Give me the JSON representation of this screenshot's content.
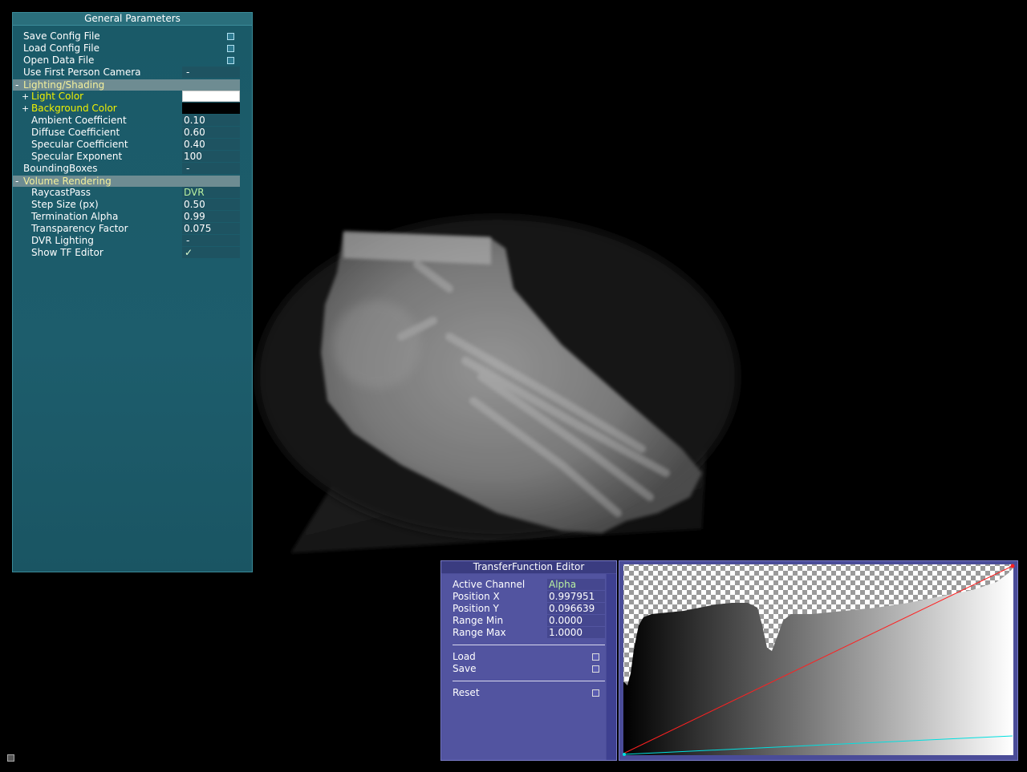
{
  "general_parameters": {
    "title": "General Parameters",
    "save_config": "Save Config File",
    "load_config": "Load Config File",
    "open_data": "Open Data File",
    "first_person_camera": {
      "label": "Use First Person Camera",
      "value": "-"
    },
    "lighting_section": "Lighting/Shading",
    "light_color": {
      "label": "Light Color",
      "color": "#ffffff"
    },
    "background_color": {
      "label": "Background Color",
      "color": "#000000"
    },
    "ambient": {
      "label": "Ambient Coefficient",
      "value": "0.10"
    },
    "diffuse": {
      "label": "Diffuse Coefficient",
      "value": "0.60"
    },
    "specular": {
      "label": "Specular Coefficient",
      "value": "0.40"
    },
    "specular_exp": {
      "label": "Specular Exponent",
      "value": "100"
    },
    "bounding_boxes": {
      "label": "BoundingBoxes",
      "value": "-"
    },
    "volume_section": "Volume Rendering",
    "raycast_pass": {
      "label": "RaycastPass",
      "value": "DVR"
    },
    "step_size": {
      "label": "Step Size (px)",
      "value": "0.50"
    },
    "termination_alpha": {
      "label": "Termination Alpha",
      "value": "0.99"
    },
    "transparency_factor": {
      "label": "Transparency Factor",
      "value": "0.075"
    },
    "dvr_lighting": {
      "label": "DVR Lighting",
      "value": "-"
    },
    "show_tf_editor": {
      "label": "Show TF Editor",
      "value": "✓"
    }
  },
  "tf_editor": {
    "title": "TransferFunction Editor",
    "active_channel": {
      "label": "Active Channel",
      "value": "Alpha"
    },
    "position_x": {
      "label": "Position X",
      "value": "0.997951"
    },
    "position_y": {
      "label": "Position Y",
      "value": "0.096639"
    },
    "range_min": {
      "label": "Range Min",
      "value": "0.0000"
    },
    "range_max": {
      "label": "Range Max",
      "value": "1.0000"
    },
    "load": "Load",
    "save": "Save",
    "reset": "Reset"
  },
  "colors": {
    "panel_bg": "#1d5d6c",
    "tf_bg": "#4a4c98",
    "alpha_line": "#ff2020",
    "color_line": "#00e0e0"
  }
}
